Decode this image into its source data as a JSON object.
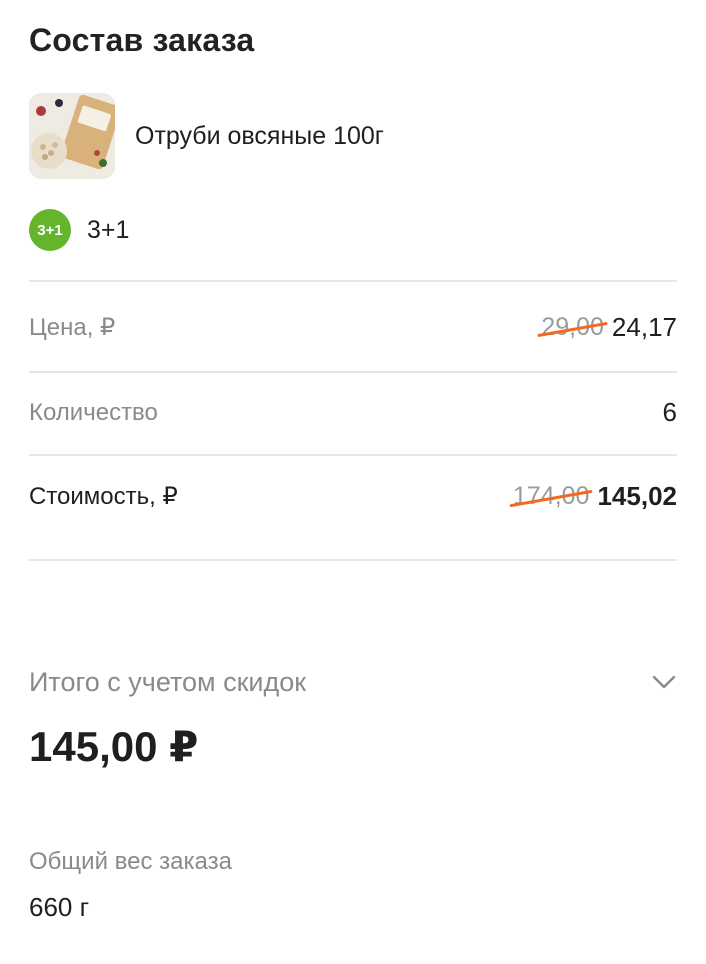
{
  "order": {
    "title": "Состав заказа",
    "product": {
      "name": "Отруби овсяные 100г",
      "image_icon": "product-image"
    },
    "promo": {
      "badge": "3+1",
      "label": "3+1",
      "color": "#64b52c"
    },
    "lines": {
      "price": {
        "label": "Цена, ₽",
        "old": "29,00",
        "current": "24,17"
      },
      "quantity": {
        "label": "Количество",
        "value": "6"
      },
      "cost": {
        "label": "Стоимость, ₽",
        "old": "174,00",
        "current": "145,02"
      }
    },
    "strike_color": "#f26a21"
  },
  "total": {
    "label": "Итого с учетом скидок",
    "value": "145,00 ₽",
    "toggle_icon": "chevron-down-icon"
  },
  "weight": {
    "label": "Общий вес заказа",
    "value": "660 г"
  }
}
